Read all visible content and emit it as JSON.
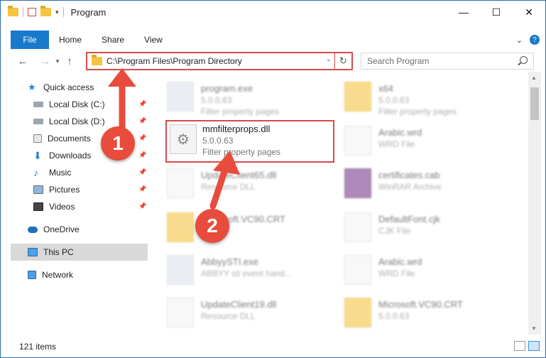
{
  "window": {
    "title": "Program"
  },
  "ribbon": {
    "tabs": [
      "File",
      "Home",
      "Share",
      "View"
    ],
    "help": "?"
  },
  "address": {
    "path": "C:\\Program Files\\Program Directory",
    "search_placeholder": "Search Program"
  },
  "sidebar": {
    "items": [
      {
        "label": "Quick access",
        "icon": "star-icon"
      },
      {
        "label": "Local Disk (C:)",
        "icon": "drive-icon"
      },
      {
        "label": "Local Disk (D:)",
        "icon": "drive-icon"
      },
      {
        "label": "Documents",
        "icon": "documents-icon"
      },
      {
        "label": "Downloads",
        "icon": "download-icon"
      },
      {
        "label": "Music",
        "icon": "music-icon"
      },
      {
        "label": "Pictures",
        "icon": "pictures-icon"
      },
      {
        "label": "Videos",
        "icon": "videos-icon"
      },
      {
        "label": "OneDrive",
        "icon": "cloud-icon"
      },
      {
        "label": "This PC",
        "icon": "computer-icon"
      },
      {
        "label": "Network",
        "icon": "network-icon"
      }
    ]
  },
  "files": [
    {
      "name": "program.exe",
      "sub1": "5.0.0.63",
      "sub2": "Filter property pages"
    },
    {
      "name": "x64",
      "sub1": "5.0.0.63",
      "sub2": "Filter property pages"
    },
    {
      "name": "mmfilterprops.dll",
      "sub1": "5.0.0.63",
      "sub2": "Filter property pages"
    },
    {
      "name": "Arabic.wrd",
      "sub1": "WRD File",
      "sub2": ""
    },
    {
      "name": "UpdateClient65.dll",
      "sub1": "Resource DLL",
      "sub2": ""
    },
    {
      "name": "certificates.cab",
      "sub1": "WinRAR Archive",
      "sub2": ""
    },
    {
      "name": "Microsoft.VC90.CRT",
      "sub1": "",
      "sub2": ""
    },
    {
      "name": "DefaultFont.cjk",
      "sub1": "CJK File",
      "sub2": ""
    },
    {
      "name": "AbbyySTI.exe",
      "sub1": "ABBYY sti event hand...",
      "sub2": ""
    },
    {
      "name": "Arabic.wrd",
      "sub1": "WRD File",
      "sub2": ""
    },
    {
      "name": "UpdateClient19.dll",
      "sub1": "Resource DLL",
      "sub2": ""
    },
    {
      "name": "Microsoft.VC90.CRT",
      "sub1": "5.0.0.63",
      "sub2": ""
    }
  ],
  "status": {
    "items": "121 items"
  },
  "callouts": [
    "1",
    "2"
  ],
  "colors": {
    "accent": "#1979ca",
    "highlight": "#d84a4a",
    "callout": "#e74c3c"
  }
}
